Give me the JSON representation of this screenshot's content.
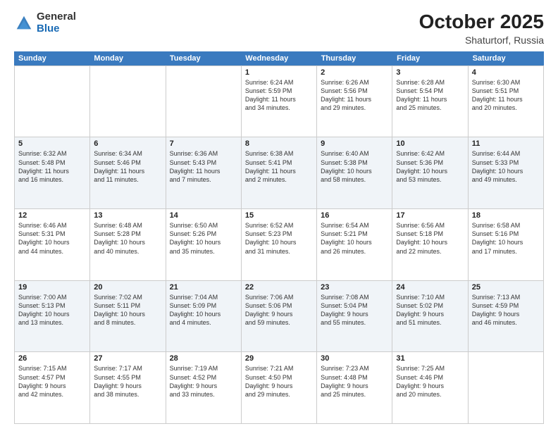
{
  "logo": {
    "general": "General",
    "blue": "Blue"
  },
  "title": {
    "month": "October 2025",
    "location": "Shaturtorf, Russia"
  },
  "header": {
    "days": [
      "Sunday",
      "Monday",
      "Tuesday",
      "Wednesday",
      "Thursday",
      "Friday",
      "Saturday"
    ]
  },
  "weeks": [
    [
      {
        "day": "",
        "detail": ""
      },
      {
        "day": "",
        "detail": ""
      },
      {
        "day": "",
        "detail": ""
      },
      {
        "day": "1",
        "detail": "Sunrise: 6:24 AM\nSunset: 5:59 PM\nDaylight: 11 hours\nand 34 minutes."
      },
      {
        "day": "2",
        "detail": "Sunrise: 6:26 AM\nSunset: 5:56 PM\nDaylight: 11 hours\nand 29 minutes."
      },
      {
        "day": "3",
        "detail": "Sunrise: 6:28 AM\nSunset: 5:54 PM\nDaylight: 11 hours\nand 25 minutes."
      },
      {
        "day": "4",
        "detail": "Sunrise: 6:30 AM\nSunset: 5:51 PM\nDaylight: 11 hours\nand 20 minutes."
      }
    ],
    [
      {
        "day": "5",
        "detail": "Sunrise: 6:32 AM\nSunset: 5:48 PM\nDaylight: 11 hours\nand 16 minutes."
      },
      {
        "day": "6",
        "detail": "Sunrise: 6:34 AM\nSunset: 5:46 PM\nDaylight: 11 hours\nand 11 minutes."
      },
      {
        "day": "7",
        "detail": "Sunrise: 6:36 AM\nSunset: 5:43 PM\nDaylight: 11 hours\nand 7 minutes."
      },
      {
        "day": "8",
        "detail": "Sunrise: 6:38 AM\nSunset: 5:41 PM\nDaylight: 11 hours\nand 2 minutes."
      },
      {
        "day": "9",
        "detail": "Sunrise: 6:40 AM\nSunset: 5:38 PM\nDaylight: 10 hours\nand 58 minutes."
      },
      {
        "day": "10",
        "detail": "Sunrise: 6:42 AM\nSunset: 5:36 PM\nDaylight: 10 hours\nand 53 minutes."
      },
      {
        "day": "11",
        "detail": "Sunrise: 6:44 AM\nSunset: 5:33 PM\nDaylight: 10 hours\nand 49 minutes."
      }
    ],
    [
      {
        "day": "12",
        "detail": "Sunrise: 6:46 AM\nSunset: 5:31 PM\nDaylight: 10 hours\nand 44 minutes."
      },
      {
        "day": "13",
        "detail": "Sunrise: 6:48 AM\nSunset: 5:28 PM\nDaylight: 10 hours\nand 40 minutes."
      },
      {
        "day": "14",
        "detail": "Sunrise: 6:50 AM\nSunset: 5:26 PM\nDaylight: 10 hours\nand 35 minutes."
      },
      {
        "day": "15",
        "detail": "Sunrise: 6:52 AM\nSunset: 5:23 PM\nDaylight: 10 hours\nand 31 minutes."
      },
      {
        "day": "16",
        "detail": "Sunrise: 6:54 AM\nSunset: 5:21 PM\nDaylight: 10 hours\nand 26 minutes."
      },
      {
        "day": "17",
        "detail": "Sunrise: 6:56 AM\nSunset: 5:18 PM\nDaylight: 10 hours\nand 22 minutes."
      },
      {
        "day": "18",
        "detail": "Sunrise: 6:58 AM\nSunset: 5:16 PM\nDaylight: 10 hours\nand 17 minutes."
      }
    ],
    [
      {
        "day": "19",
        "detail": "Sunrise: 7:00 AM\nSunset: 5:13 PM\nDaylight: 10 hours\nand 13 minutes."
      },
      {
        "day": "20",
        "detail": "Sunrise: 7:02 AM\nSunset: 5:11 PM\nDaylight: 10 hours\nand 8 minutes."
      },
      {
        "day": "21",
        "detail": "Sunrise: 7:04 AM\nSunset: 5:09 PM\nDaylight: 10 hours\nand 4 minutes."
      },
      {
        "day": "22",
        "detail": "Sunrise: 7:06 AM\nSunset: 5:06 PM\nDaylight: 9 hours\nand 59 minutes."
      },
      {
        "day": "23",
        "detail": "Sunrise: 7:08 AM\nSunset: 5:04 PM\nDaylight: 9 hours\nand 55 minutes."
      },
      {
        "day": "24",
        "detail": "Sunrise: 7:10 AM\nSunset: 5:02 PM\nDaylight: 9 hours\nand 51 minutes."
      },
      {
        "day": "25",
        "detail": "Sunrise: 7:13 AM\nSunset: 4:59 PM\nDaylight: 9 hours\nand 46 minutes."
      }
    ],
    [
      {
        "day": "26",
        "detail": "Sunrise: 7:15 AM\nSunset: 4:57 PM\nDaylight: 9 hours\nand 42 minutes."
      },
      {
        "day": "27",
        "detail": "Sunrise: 7:17 AM\nSunset: 4:55 PM\nDaylight: 9 hours\nand 38 minutes."
      },
      {
        "day": "28",
        "detail": "Sunrise: 7:19 AM\nSunset: 4:52 PM\nDaylight: 9 hours\nand 33 minutes."
      },
      {
        "day": "29",
        "detail": "Sunrise: 7:21 AM\nSunset: 4:50 PM\nDaylight: 9 hours\nand 29 minutes."
      },
      {
        "day": "30",
        "detail": "Sunrise: 7:23 AM\nSunset: 4:48 PM\nDaylight: 9 hours\nand 25 minutes."
      },
      {
        "day": "31",
        "detail": "Sunrise: 7:25 AM\nSunset: 4:46 PM\nDaylight: 9 hours\nand 20 minutes."
      },
      {
        "day": "",
        "detail": ""
      }
    ]
  ]
}
